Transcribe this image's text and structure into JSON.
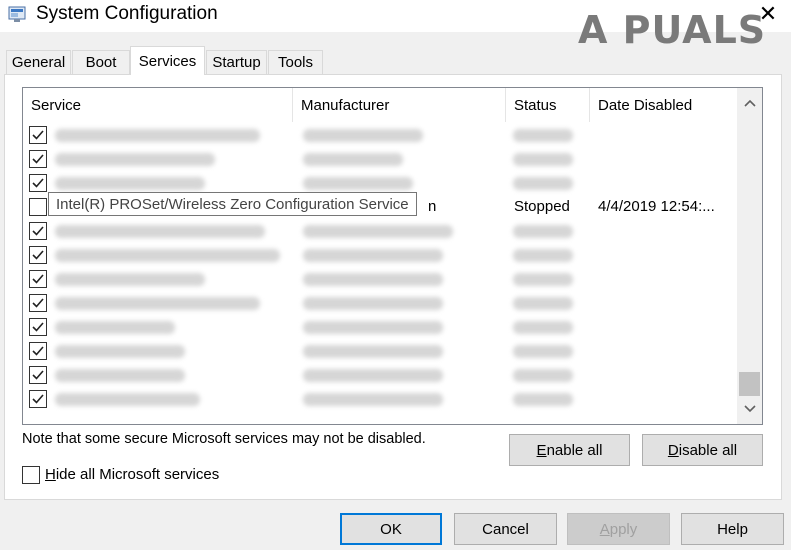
{
  "window": {
    "title": "System Configuration",
    "close_glyph": "✕"
  },
  "watermark": {
    "text": "A PUALS"
  },
  "tabs": [
    {
      "label": "General",
      "active": false
    },
    {
      "label": "Boot",
      "active": false
    },
    {
      "label": "Services",
      "active": true
    },
    {
      "label": "Startup",
      "active": false
    },
    {
      "label": "Tools",
      "active": false
    }
  ],
  "list": {
    "columns": [
      "Service",
      "Manufacturer",
      "Status",
      "Date Disabled"
    ],
    "rows": [
      {
        "checked": true
      },
      {
        "checked": true
      },
      {
        "checked": true
      },
      {
        "checked": false,
        "status": "Stopped",
        "date_disabled": "4/4/2019 12:54:...",
        "manufacturer_suffix": "n"
      },
      {
        "checked": true
      },
      {
        "checked": true
      },
      {
        "checked": true
      },
      {
        "checked": true
      },
      {
        "checked": true
      },
      {
        "checked": true
      },
      {
        "checked": true
      },
      {
        "checked": true
      }
    ],
    "tooltip": "Intel(R) PROSet/Wireless Zero Configuration Service"
  },
  "note": "Note that some secure Microsoft services may not be disabled.",
  "buttons": {
    "enable_all": {
      "accel": "E",
      "rest": "nable all"
    },
    "disable_all": {
      "accel": "D",
      "rest": "isable all"
    },
    "ok": "OK",
    "cancel": "Cancel",
    "apply": {
      "accel": "A",
      "rest": "pply"
    },
    "help": "Help"
  },
  "hide_ms": {
    "accel": "H",
    "rest": "ide all Microsoft services",
    "checked": false
  },
  "colors": {
    "accent": "#0078d7",
    "tab_border": "#d9d9d9"
  }
}
